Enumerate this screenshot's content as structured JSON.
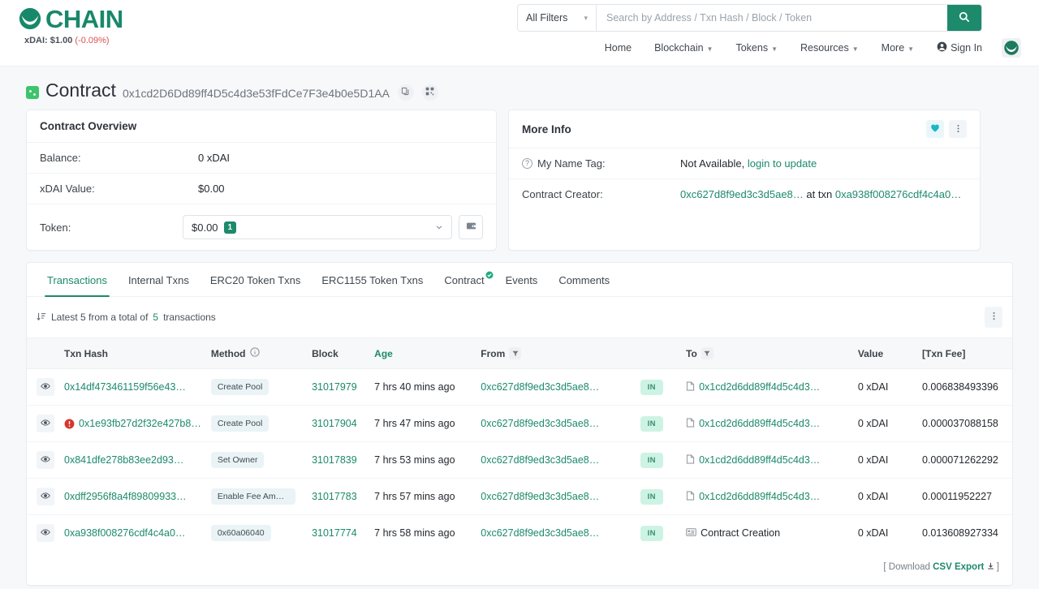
{
  "header": {
    "brand_name": "CHAIN",
    "ticker_label": "xDAI: $1.00",
    "ticker_change": "(-0.09%)",
    "accent_color": "#1c8a6b",
    "search": {
      "filter_label": "All Filters",
      "placeholder": "Search by Address / Txn Hash / Block / Token",
      "value": "",
      "submit_icon": "search-icon"
    },
    "nav": [
      {
        "label": "Home",
        "caret": false
      },
      {
        "label": "Blockchain",
        "caret": true
      },
      {
        "label": "Tokens",
        "caret": true
      },
      {
        "label": "Resources",
        "caret": true
      },
      {
        "label": "More",
        "caret": true
      },
      {
        "label": "Sign In",
        "caret": false,
        "icon": "user-circle-icon"
      }
    ],
    "avatar_icon": "owl-avatar-icon"
  },
  "page": {
    "type_label": "Contract",
    "address": "0x1cd2D6Dd89ff4D5c4d3e53fFdCe7F3e4b0e5D1AA",
    "copy_icon": "copy-icon",
    "qr_icon": "qr-code-icon"
  },
  "overview": {
    "title": "Contract Overview",
    "rows": [
      {
        "label": "Balance:",
        "value": "0 xDAI"
      },
      {
        "label": "xDAI Value:",
        "value": "$0.00"
      }
    ],
    "token": {
      "label": "Token:",
      "selected": "$0.00",
      "count": "1",
      "chevron_icon": "chevron-down-icon",
      "wallet_icon": "wallet-icon"
    }
  },
  "more_info": {
    "title": "More Info",
    "heart_icon": "heart-icon",
    "menu_icon": "kebab-menu-icon",
    "name_tag": {
      "label": "My Name Tag:",
      "help_icon": "question-circle-icon",
      "value": "Not Available,",
      "link": "login to update"
    },
    "creator": {
      "label": "Contract Creator:",
      "address": "0xc627d8f9ed3c3d5ae8…",
      "joiner": "at txn",
      "txn": "0xa938f008276cdf4c4a0…"
    }
  },
  "tabs": [
    {
      "label": "Transactions",
      "active": true,
      "verified": false
    },
    {
      "label": "Internal Txns",
      "active": false,
      "verified": false
    },
    {
      "label": "ERC20 Token Txns",
      "active": false,
      "verified": false
    },
    {
      "label": "ERC1155 Token Txns",
      "active": false,
      "verified": false
    },
    {
      "label": "Contract",
      "active": false,
      "verified": true
    },
    {
      "label": "Events",
      "active": false,
      "verified": false
    },
    {
      "label": "Comments",
      "active": false,
      "verified": false
    }
  ],
  "table": {
    "summary_prefix": "Latest 5 from a total of",
    "summary_count": "5",
    "summary_suffix": "transactions",
    "sort_icon": "sort-descending-icon",
    "menu_icon": "kebab-menu-icon",
    "columns": [
      {
        "label": "Txn Hash",
        "icon": null
      },
      {
        "label": "Method",
        "icon": "info-circle-icon"
      },
      {
        "label": "Block",
        "icon": null
      },
      {
        "label": "Age",
        "icon": null
      },
      {
        "label": "From",
        "icon": "filter-icon"
      },
      {
        "label": "",
        "icon": null
      },
      {
        "label": "To",
        "icon": "filter-icon"
      },
      {
        "label": "Value",
        "icon": null
      },
      {
        "label": "[Txn Fee]",
        "icon": null
      }
    ],
    "rows": [
      {
        "eye_icon": "eye-icon",
        "warning": false,
        "hash": "0x14df473461159f56e43…",
        "method": "Create Pool",
        "block": "31017979",
        "age": "7 hrs 40 mins ago",
        "from": "0xc627d8f9ed3c3d5ae8…",
        "direction": "IN",
        "to_icon": "contract-file-icon",
        "to": "0x1cd2d6dd89ff4d5c4d3…",
        "value": "0 xDAI",
        "fee": "0.006838493396"
      },
      {
        "eye_icon": "eye-icon",
        "warning": true,
        "hash": "0x1e93fb27d2f32e427b8…",
        "method": "Create Pool",
        "block": "31017904",
        "age": "7 hrs 47 mins ago",
        "from": "0xc627d8f9ed3c3d5ae8…",
        "direction": "IN",
        "to_icon": "contract-file-icon",
        "to": "0x1cd2d6dd89ff4d5c4d3…",
        "value": "0 xDAI",
        "fee": "0.000037088158"
      },
      {
        "eye_icon": "eye-icon",
        "warning": false,
        "hash": "0x841dfe278b83ee2d93…",
        "method": "Set Owner",
        "block": "31017839",
        "age": "7 hrs 53 mins ago",
        "from": "0xc627d8f9ed3c3d5ae8…",
        "direction": "IN",
        "to_icon": "contract-file-icon",
        "to": "0x1cd2d6dd89ff4d5c4d3…",
        "value": "0 xDAI",
        "fee": "0.000071262292"
      },
      {
        "eye_icon": "eye-icon",
        "warning": false,
        "hash": "0xdff2956f8a4f89809933…",
        "method": "Enable Fee Amoun…",
        "block": "31017783",
        "age": "7 hrs 57 mins ago",
        "from": "0xc627d8f9ed3c3d5ae8…",
        "direction": "IN",
        "to_icon": "contract-file-icon",
        "to": "0x1cd2d6dd89ff4d5c4d3…",
        "value": "0 xDAI",
        "fee": "0.00011952227"
      },
      {
        "eye_icon": "eye-icon",
        "warning": false,
        "hash": "0xa938f008276cdf4c4a0…",
        "method": "0x60a06040",
        "block": "31017774",
        "age": "7 hrs 58 mins ago",
        "from": "0xc627d8f9ed3c3d5ae8…",
        "direction": "IN",
        "to_icon": "contract-creation-icon",
        "to": "Contract Creation",
        "value": "0 xDAI",
        "fee": "0.013608927334"
      }
    ],
    "footer": {
      "open_bracket": "[",
      "download_label": "Download",
      "csv_label": "CSV Export",
      "download_icon": "download-icon",
      "close_bracket": "]"
    }
  }
}
